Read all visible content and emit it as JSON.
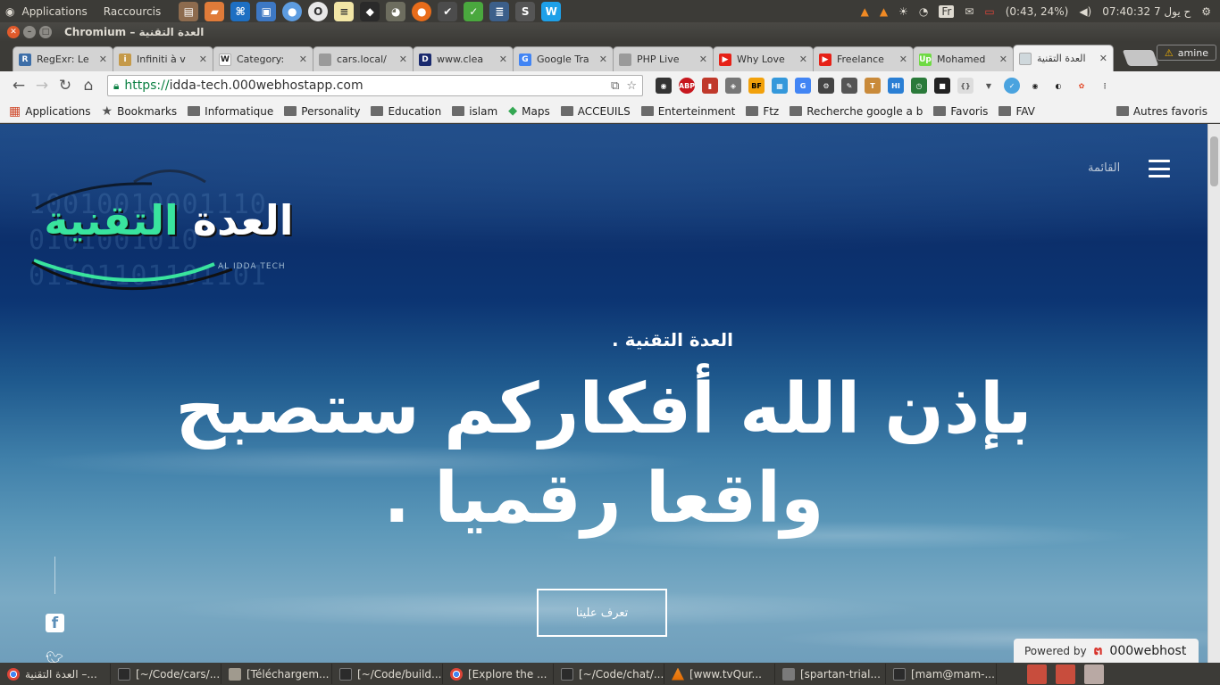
{
  "topbar": {
    "menu_applications": "Applications",
    "menu_shortcuts": "Raccourcis",
    "tray": {
      "keyboard": "Fr",
      "battery": "(0:43, 24%)",
      "clock": "07:40:32 7 ح يول"
    }
  },
  "window": {
    "title": "Chromium – العدة التقنية"
  },
  "tabs": [
    {
      "title": "RegExr: Le",
      "favicon_color": "#3d6ea8",
      "favicon_text": "R"
    },
    {
      "title": "Infiniti à v",
      "favicon_color": "#c59a4a",
      "favicon_text": "i"
    },
    {
      "title": "Category:",
      "favicon_color": "#ffffff",
      "favicon_text": "W"
    },
    {
      "title": "cars.local/",
      "favicon_color": "#9a9a9a",
      "favicon_text": ""
    },
    {
      "title": "www.clea",
      "favicon_color": "#1a2a6e",
      "favicon_text": "D"
    },
    {
      "title": "Google Tra",
      "favicon_color": "#4285f4",
      "favicon_text": "G"
    },
    {
      "title": "PHP Live",
      "favicon_color": "#9a9a9a",
      "favicon_text": ""
    },
    {
      "title": "Why Love",
      "favicon_color": "#e62117",
      "favicon_text": "▶"
    },
    {
      "title": "Freelance",
      "favicon_color": "#e62117",
      "favicon_text": "▶"
    },
    {
      "title": "Mohamed",
      "favicon_color": "#6fda44",
      "favicon_text": "Up"
    },
    {
      "title": "العدة التقنية",
      "favicon_color": "#cfd8dc",
      "favicon_text": "",
      "active": true
    }
  ],
  "profile": {
    "name": "amine"
  },
  "toolbar": {
    "url_scheme": "https://",
    "url_host": "idda-tech.000webhostapp.com"
  },
  "bookmarks": [
    {
      "label": "Applications",
      "icon": "apps-icon"
    },
    {
      "label": "Bookmarks",
      "icon": "star-icon"
    },
    {
      "label": "Informatique",
      "icon": "folder-icon"
    },
    {
      "label": "Personality",
      "icon": "folder-icon"
    },
    {
      "label": "Education",
      "icon": "folder-icon"
    },
    {
      "label": "islam",
      "icon": "folder-icon"
    },
    {
      "label": "Maps",
      "icon": "maps-icon"
    },
    {
      "label": "ACCEUILS",
      "icon": "folder-icon"
    },
    {
      "label": "Enterteinment",
      "icon": "folder-icon"
    },
    {
      "label": "Ftz",
      "icon": "folder-icon"
    },
    {
      "label": "Recherche google a b",
      "icon": "folder-icon"
    },
    {
      "label": "Favoris",
      "icon": "folder-icon"
    },
    {
      "label": "FAV",
      "icon": "folder-icon"
    }
  ],
  "bookmarks_other": "Autres favoris",
  "site": {
    "logo_binary": "10010010001110\n0101001010\n01101101101101",
    "logo_text_white": "العدة",
    "logo_text_green": "التقنية",
    "logo_sub": "AL IDDA TECH",
    "menu_label": "القائمة",
    "hero_small": "العدة التقنية .",
    "hero_big": "بإذن الله أفكاركم ستصبح واقعا رقميا .",
    "cta_label": "تعرف علينا",
    "powered_prefix": "Powered by",
    "powered_brand": "000webhost"
  },
  "taskbar": [
    {
      "label": "العدة التقنية –...",
      "icon": "chrome"
    },
    {
      "label": "[~/Code/cars/...",
      "icon": "term"
    },
    {
      "label": "[Téléchargem...",
      "icon": "folder"
    },
    {
      "label": "[~/Code/build...",
      "icon": "term"
    },
    {
      "label": "[Explore the ...",
      "icon": "chrome"
    },
    {
      "label": "[~/Code/chat/...",
      "icon": "term"
    },
    {
      "label": "[www.tvQur...",
      "icon": "vlc"
    },
    {
      "label": "[spartan-trial...",
      "icon": "dl"
    },
    {
      "label": "[mam@mam-...",
      "icon": "term"
    }
  ]
}
